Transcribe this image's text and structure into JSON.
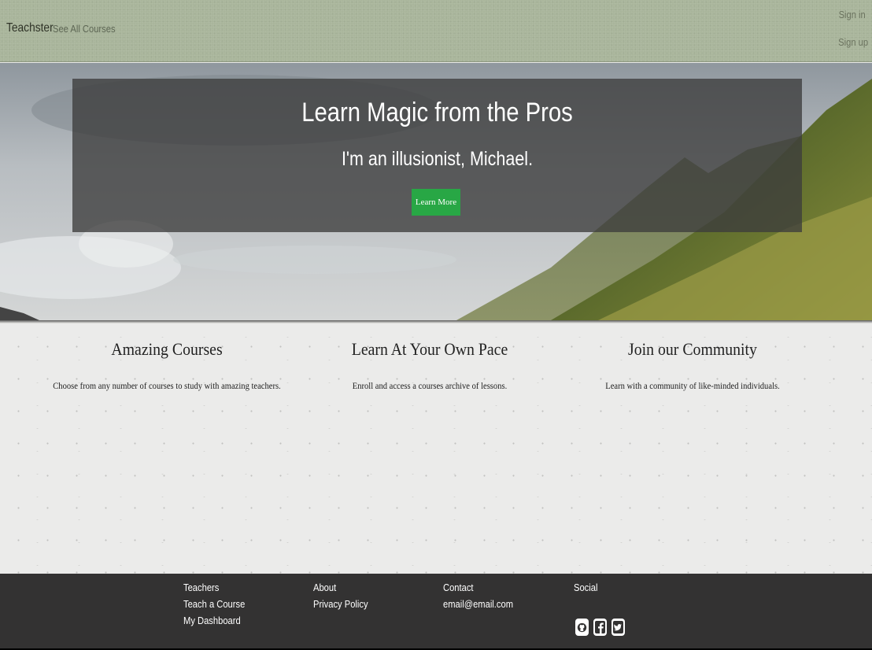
{
  "navbar": {
    "brand": "Teachster",
    "courses_link": "See All Courses",
    "sign_in": "Sign in",
    "sign_up": "Sign up"
  },
  "hero": {
    "title": "Learn Magic from the Pros",
    "subtitle": "I'm an illusionist, Michael.",
    "button_label": "Learn More"
  },
  "features": [
    {
      "title": "Amazing Courses",
      "text": "Choose from any number of courses to study with amazing teachers."
    },
    {
      "title": "Learn At Your Own Pace",
      "text": "Enroll and access a courses archive of lessons."
    },
    {
      "title": "Join our Community",
      "text": "Learn with a community of like-minded individuals."
    }
  ],
  "footer": {
    "col1": [
      "Teachers",
      "Teach a Course",
      "My Dashboard"
    ],
    "col2": [
      "About",
      "Privacy Policy"
    ],
    "col3": [
      "Contact",
      "email@email.com"
    ],
    "col4_title": "Social",
    "social_icons": [
      "github-icon",
      "facebook-icon",
      "twitter-icon"
    ]
  },
  "colors": {
    "navbar": "#a9b59b",
    "button": "#28a745",
    "footer": "#333232"
  }
}
